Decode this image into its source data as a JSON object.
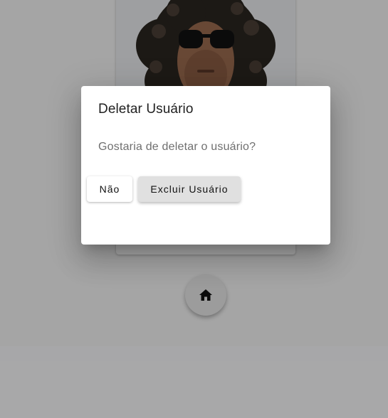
{
  "user_card": {
    "photo_alt": "user-photo"
  },
  "home_button": {
    "icon": "home-icon"
  },
  "dialog": {
    "title": "Deletar Usuário",
    "message": "Gostaria de deletar o usuário?",
    "cancel_label": "Não",
    "confirm_label": "Excluir Usuário"
  },
  "colors": {
    "backdrop": "#000000",
    "dialog_bg": "#ffffff",
    "confirm_button_bg": "#e0e0e0"
  }
}
